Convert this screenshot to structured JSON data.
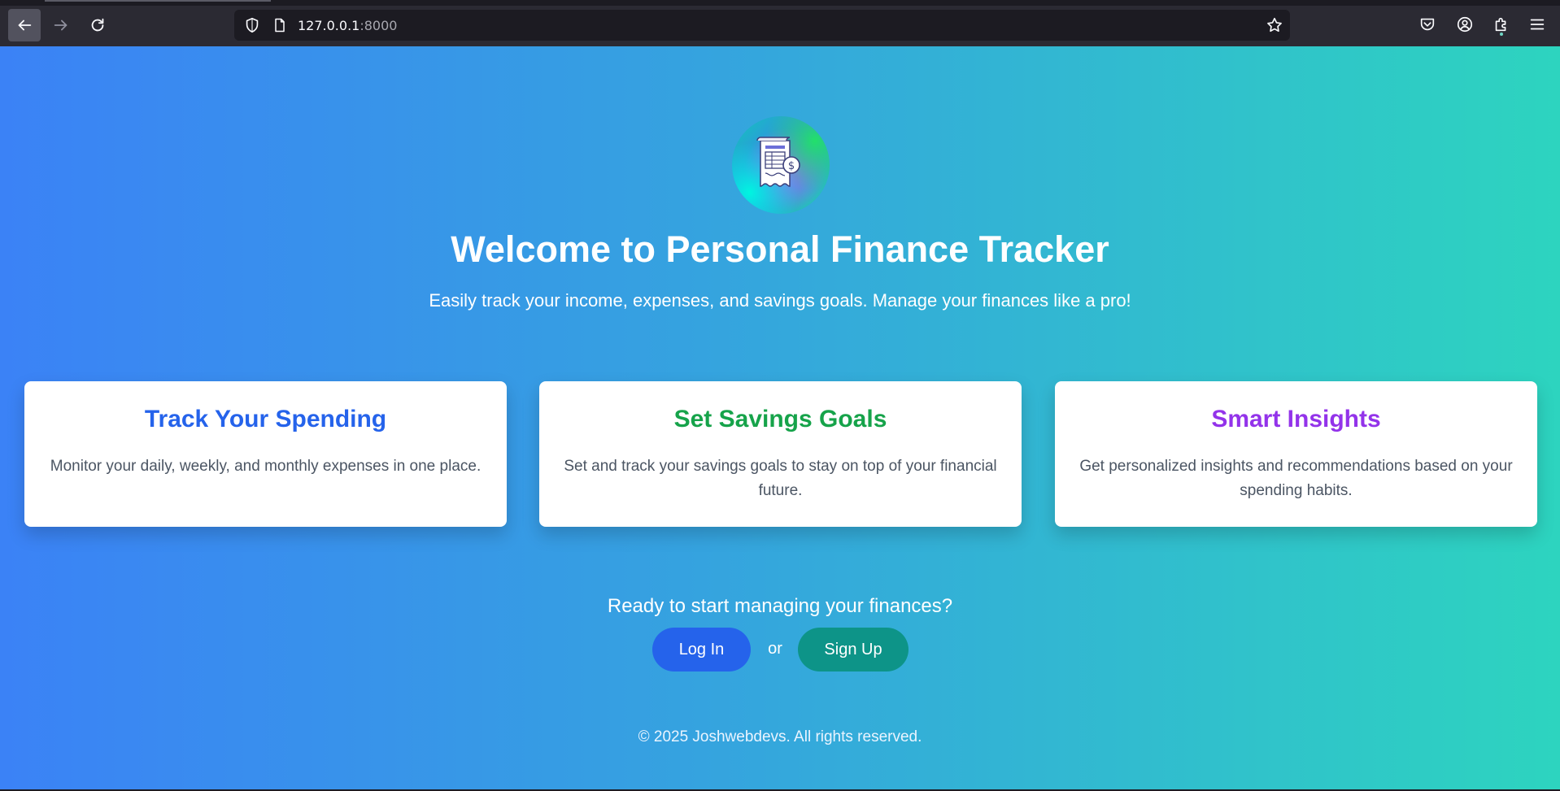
{
  "browser": {
    "url_host": "127.0.0.1",
    "url_port": ":8000",
    "icons": [
      "back-arrow-icon",
      "forward-arrow-icon",
      "reload-icon",
      "shield-icon",
      "page-icon",
      "star-icon",
      "pocket-icon",
      "account-icon",
      "extensions-icon",
      "menu-icon"
    ]
  },
  "hero": {
    "logo_icon": "receipt-dollar-icon",
    "title": "Welcome to Personal Finance Tracker",
    "subtitle": "Easily track your income, expenses, and savings goals. Manage your finances like a pro!"
  },
  "features": [
    {
      "title": "Track Your Spending",
      "text": "Monitor your daily, weekly, and monthly expenses in one place.",
      "color": "#2563eb"
    },
    {
      "title": "Set Savings Goals",
      "text": "Set and track your savings goals to stay on top of your financial future.",
      "color": "#16a34a"
    },
    {
      "title": "Smart Insights",
      "text": "Get personalized insights and recommendations based on your spending habits.",
      "color": "#9333ea"
    }
  ],
  "cta": {
    "prompt": "Ready to start managing your finances?",
    "login_label": "Log In",
    "or_label": "or",
    "signup_label": "Sign Up"
  },
  "footer": {
    "text": "© 2025 Joshwebdevs. All rights reserved."
  },
  "colors": {
    "gradient_start": "#3b82f6",
    "gradient_end": "#2dd4bf",
    "login_button": "#2563eb",
    "signup_button": "#0d9488"
  }
}
